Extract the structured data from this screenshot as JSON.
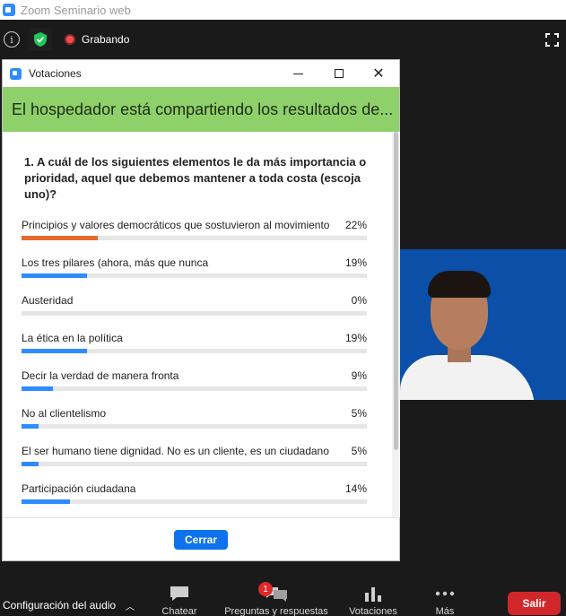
{
  "window_title": "Zoom Seminario web",
  "topbar": {
    "recording_label": "Grabando"
  },
  "poll": {
    "window_title": "Votaciones",
    "banner": "El hospedador está compartiendo los resultados de...",
    "question": "1. A cuál de los siguientes elementos le da más importancia o prioridad, aquel que debemos mantener a toda costa (escoja uno)?",
    "accent_color": "#e8692c",
    "bar_color": "#2d8cff",
    "options": [
      {
        "label": "Principios y valores democráticos que sostuvieron al movimiento",
        "percent_label": "22%",
        "value": 22
      },
      {
        "label": "Los tres pilares (ahora, más que nunca",
        "percent_label": "19%",
        "value": 19
      },
      {
        "label": "Austeridad",
        "percent_label": "0%",
        "value": 0
      },
      {
        "label": "La ética en la política",
        "percent_label": "19%",
        "value": 19
      },
      {
        "label": "Decir la verdad de manera fronta",
        "percent_label": "9%",
        "value": 9
      },
      {
        "label": "No al clientelismo",
        "percent_label": "5%",
        "value": 5
      },
      {
        "label": "El ser humano tiene dignidad. No es un cliente, es un ciudadano",
        "percent_label": "5%",
        "value": 5
      },
      {
        "label": "Participación ciudadana",
        "percent_label": "14%",
        "value": 14
      }
    ],
    "close_label": "Cerrar"
  },
  "toolbar": {
    "audio_label": "Configuración del audio",
    "items": [
      {
        "label": "Chatear",
        "icon": "chat-icon"
      },
      {
        "label": "Preguntas y respuestas",
        "icon": "qa-icon",
        "badge": "1"
      },
      {
        "label": "Votaciones",
        "icon": "polls-icon"
      },
      {
        "label": "Más",
        "icon": "more-icon"
      }
    ],
    "leave_label": "Salir"
  }
}
